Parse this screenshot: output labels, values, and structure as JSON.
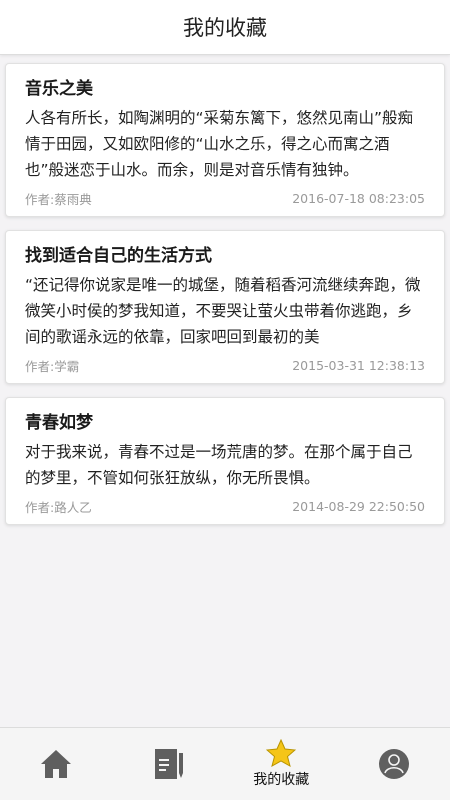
{
  "header": {
    "title": "我的收藏"
  },
  "favorites": [
    {
      "title": "音乐之美",
      "body": "人各有所长，如陶渊明的“采菊东篱下，悠然见南山”般痴情于田园，又如欧阳修的“山水之乐，得之心而寓之酒也”般迷恋于山水。而余，则是对音乐情有独钟。",
      "author": "作者:蔡雨典",
      "time": "2016-07-18 08:23:05"
    },
    {
      "title": "找到适合自己的生活方式",
      "body": "“还记得你说家是唯一的城堡，随着稻香河流继续奔跑，微微笑小时侯的梦我知道，不要哭让萤火虫带着你逃跑，乡间的歌谣永远的依靠，回家吧回到最初的美",
      "author": "作者:学霸",
      "time": "2015-03-31 12:38:13"
    },
    {
      "title": "青春如梦",
      "body": "对于我来说，青春不过是一场荒唐的梦。在那个属于自己的梦里，不管如何张狂放纵，你无所畏惧。",
      "author": "作者:路人乙",
      "time": "2014-08-29 22:50:50"
    }
  ],
  "tabbar": {
    "tabs": [
      {
        "icon": "home-icon"
      },
      {
        "icon": "document-edit-icon"
      },
      {
        "icon": "star-icon",
        "label": "我的收藏",
        "active": true
      },
      {
        "icon": "user-icon"
      }
    ]
  },
  "colors": {
    "star": "#f5c518",
    "icon_gray": "#5f5f5f"
  }
}
